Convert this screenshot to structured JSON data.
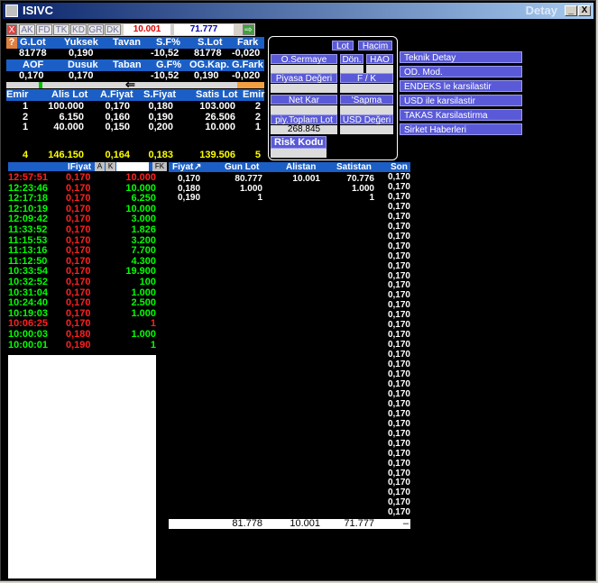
{
  "window": {
    "title": "ISIVC",
    "right_label": "Detay",
    "min_label": "_",
    "close_label": "X"
  },
  "toolbar": {
    "close_label": "X",
    "tabs": [
      "AK",
      "FD",
      "TK",
      "KD",
      "GR",
      "DK"
    ],
    "value1": "10.001",
    "value2": "71.777",
    "go_label": "⇨"
  },
  "summary": {
    "headers1": [
      "G.Lot",
      "Yuksek",
      "Tavan",
      "S.F%",
      "S.Lot",
      "Fark"
    ],
    "values1": [
      "81778",
      "0,190",
      "",
      "-10,52",
      "81778",
      "-0,020"
    ],
    "headers2": [
      "AOF",
      "Dusuk",
      "Taban",
      "G.F%",
      "OG.Kap.",
      "G.Fark"
    ],
    "values2": [
      "0,170",
      "0,170",
      "",
      "-10,52",
      "0,190",
      "-0,020"
    ],
    "arrow": "⇐"
  },
  "depth": {
    "headers": [
      "Emir",
      "Alis Lot",
      "A.Fiyat",
      "S.Fiyat",
      "Satis Lot",
      "Emir"
    ],
    "rows": [
      [
        "1",
        "100.000",
        "0,170",
        "0,180",
        "103.000",
        "2"
      ],
      [
        "2",
        "6.150",
        "0,160",
        "0,190",
        "26.506",
        "2"
      ],
      [
        "1",
        "40.000",
        "0,150",
        "0,200",
        "10.000",
        "1"
      ]
    ],
    "totals": [
      "4",
      "146.150",
      "0,164",
      "0,183",
      "139.506",
      "5"
    ]
  },
  "panel": {
    "lot": "Lot",
    "hacim": "Hacim",
    "o_sermaye": "O.Sermaye",
    "don": "Dön.",
    "hao": "HAO",
    "piyasa_degeri": "Piyasa Değeri",
    "fk": "F / K",
    "net_kar": "Net Kar",
    "sapma": "'Sapma",
    "piy_toplam_lot": "piy.Toplam Lot",
    "usd_degeri": "USD Değeri",
    "toplam_lot_value": "268.845",
    "risk_kodu": "Risk Kodu"
  },
  "right_menu": [
    "Teknik Detay",
    "OD. Mod.",
    "ENDEKS le karsilastir",
    "USD ile karsilastir",
    "TAKAS Karsilastirma",
    "Sirket Haberleri"
  ],
  "trades": {
    "header_label": "IFiyat",
    "btn_a": "A",
    "btn_k": "K",
    "btn_fk": "FK",
    "rows": [
      {
        "t": "12:57:51",
        "p": "0,170",
        "v": "10.000",
        "c": "r"
      },
      {
        "t": "12:23:46",
        "p": "0,170",
        "v": "10.000",
        "c": "g"
      },
      {
        "t": "12:17:18",
        "p": "0,170",
        "v": "6.250",
        "c": "g"
      },
      {
        "t": "12:10:19",
        "p": "0,170",
        "v": "10.000",
        "c": "g"
      },
      {
        "t": "12:09:42",
        "p": "0,170",
        "v": "3.000",
        "c": "g"
      },
      {
        "t": "11:33:52",
        "p": "0,170",
        "v": "1.826",
        "c": "g"
      },
      {
        "t": "11:15:53",
        "p": "0,170",
        "v": "3.200",
        "c": "g"
      },
      {
        "t": "11:13:16",
        "p": "0,170",
        "v": "7.700",
        "c": "g"
      },
      {
        "t": "11:12:50",
        "p": "0,170",
        "v": "4.300",
        "c": "g"
      },
      {
        "t": "10:33:54",
        "p": "0,170",
        "v": "19.900",
        "c": "g"
      },
      {
        "t": "10:32:52",
        "p": "0,170",
        "v": "100",
        "c": "g"
      },
      {
        "t": "10:31:04",
        "p": "0,170",
        "v": "1.000",
        "c": "g"
      },
      {
        "t": "10:24:40",
        "p": "0,170",
        "v": "2.500",
        "c": "g"
      },
      {
        "t": "10:19:03",
        "p": "0,170",
        "v": "1.000",
        "c": "g"
      },
      {
        "t": "10:06:25",
        "p": "0,170",
        "v": "1",
        "c": "r"
      },
      {
        "t": "10:00:03",
        "p": "0,180",
        "v": "1.000",
        "c": "g"
      },
      {
        "t": "10:00:01",
        "p": "0,190",
        "v": "1",
        "c": "g"
      }
    ]
  },
  "orderbook": {
    "headers": [
      "Fiyat",
      "Gun Lot",
      "Alistan",
      "Satistan",
      "Son"
    ],
    "sort_icon": "↗",
    "rows": [
      [
        "0,170",
        "80.777",
        "10.001",
        "70.776"
      ],
      [
        "0,180",
        "1.000",
        "",
        "1.000"
      ],
      [
        "0,190",
        "1",
        "",
        "1"
      ]
    ],
    "son_value": "0,170",
    "son_count": 35,
    "footer": [
      "81.778",
      "10.001",
      "71.777",
      "–"
    ]
  }
}
